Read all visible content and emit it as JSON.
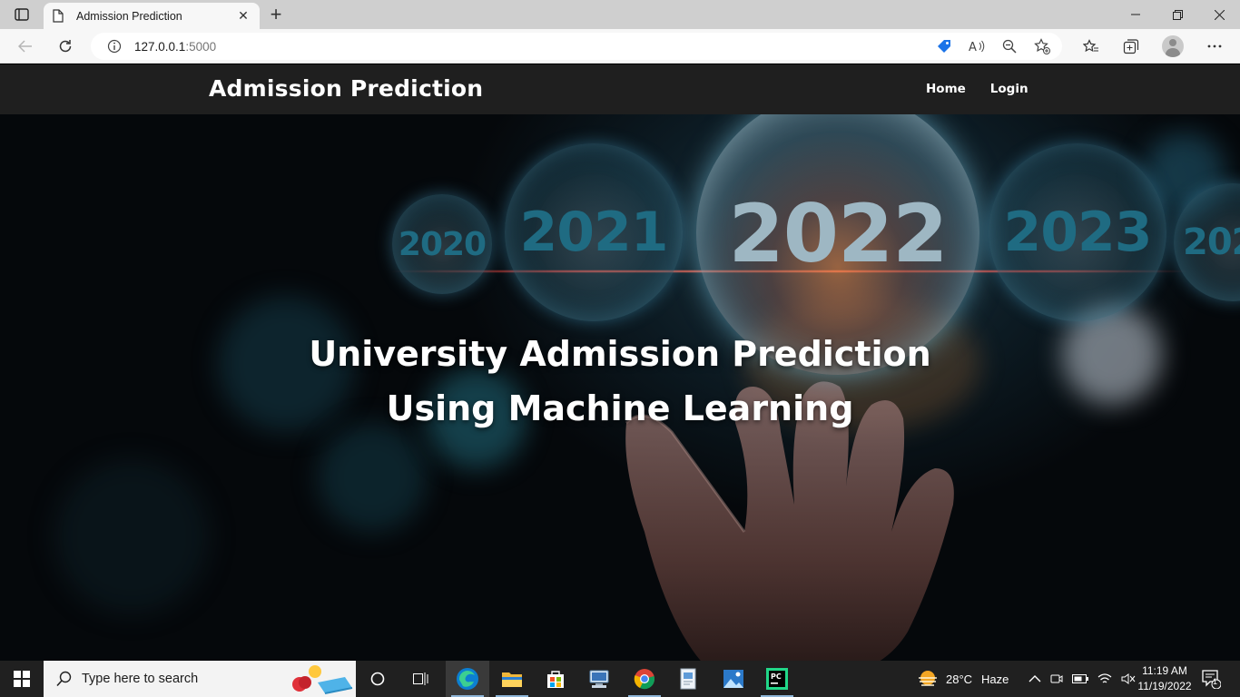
{
  "browser": {
    "tab_title": "Admission Prediction",
    "url_host": "127.0.0.1",
    "url_port": ":5000"
  },
  "navbar": {
    "brand": "Admission Prediction",
    "links": [
      "Home",
      "Login"
    ]
  },
  "hero": {
    "title_line1": "University Admission Prediction",
    "title_line2": "Using Machine Learning",
    "orb_years": [
      "2020",
      "2021",
      "2022",
      "2023",
      "202"
    ]
  },
  "taskbar": {
    "search_placeholder": "Type here to search",
    "weather_temp": "28°C",
    "weather_desc": "Haze",
    "time": "11:19 AM",
    "date": "11/19/2022",
    "notification_count": "1"
  }
}
